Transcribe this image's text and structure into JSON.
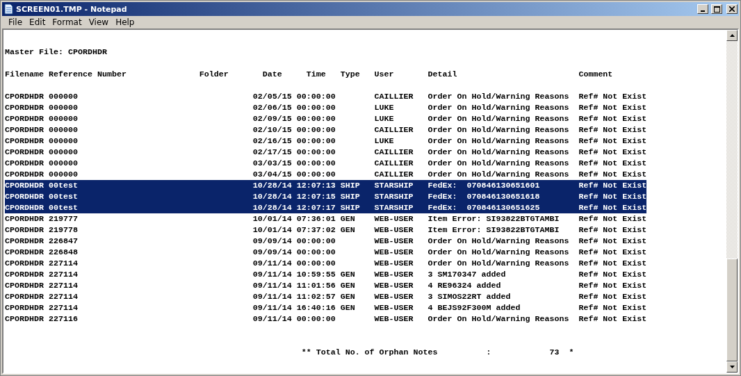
{
  "window": {
    "title": "SCREEN01.TMP - Notepad"
  },
  "menu": [
    "File",
    "Edit",
    "Format",
    "View",
    "Help"
  ],
  "document": {
    "master_line": "Master File: CPORDHDR",
    "header_line": "Filename Reference Number               Folder       Date     Time   Type   User       Detail                         Comment",
    "rows": [
      {
        "text": "CPORDHDR 000000                                    02/05/15 00:00:00        CAILLIER   Order On Hold/Warning Reasons  Ref# Not Exist",
        "selected": false
      },
      {
        "text": "CPORDHDR 000000                                    02/06/15 00:00:00        LUKE       Order On Hold/Warning Reasons  Ref# Not Exist",
        "selected": false
      },
      {
        "text": "CPORDHDR 000000                                    02/09/15 00:00:00        LUKE       Order On Hold/Warning Reasons  Ref# Not Exist",
        "selected": false
      },
      {
        "text": "CPORDHDR 000000                                    02/10/15 00:00:00        CAILLIER   Order On Hold/Warning Reasons  Ref# Not Exist",
        "selected": false
      },
      {
        "text": "CPORDHDR 000000                                    02/16/15 00:00:00        LUKE       Order On Hold/Warning Reasons  Ref# Not Exist",
        "selected": false
      },
      {
        "text": "CPORDHDR 000000                                    02/17/15 00:00:00        CAILLIER   Order On Hold/Warning Reasons  Ref# Not Exist",
        "selected": false
      },
      {
        "text": "CPORDHDR 000000                                    03/03/15 00:00:00        CAILLIER   Order On Hold/Warning Reasons  Ref# Not Exist",
        "selected": false
      },
      {
        "text": "CPORDHDR 000000                                    03/04/15 00:00:00        CAILLIER   Order On Hold/Warning Reasons  Ref# Not Exist",
        "selected": false
      },
      {
        "text": "CPORDHDR 00test                                    10/28/14 12:07:13 SHIP   STARSHIP   FedEx:  070846130651601        Ref# Not Exist",
        "selected": true
      },
      {
        "text": "CPORDHDR 00test                                    10/28/14 12:07:15 SHIP   STARSHIP   FedEx:  070846130651618        Ref# Not Exist",
        "selected": true
      },
      {
        "text": "CPORDHDR 00test                                    10/28/14 12:07:17 SHIP   STARSHIP   FedEx:  070846130651625        Ref# Not Exist",
        "selected": true
      },
      {
        "text": "CPORDHDR 219777                                    10/01/14 07:36:01 GEN    WEB-USER   Item Error: SI93822BTGTAMBI    Ref# Not Exist",
        "selected": false
      },
      {
        "text": "CPORDHDR 219778                                    10/01/14 07:37:02 GEN    WEB-USER   Item Error: SI93822BTGTAMBI    Ref# Not Exist",
        "selected": false
      },
      {
        "text": "CPORDHDR 226847                                    09/09/14 00:00:00        WEB-USER   Order On Hold/Warning Reasons  Ref# Not Exist",
        "selected": false
      },
      {
        "text": "CPORDHDR 226848                                    09/09/14 00:00:00        WEB-USER   Order On Hold/Warning Reasons  Ref# Not Exist",
        "selected": false
      },
      {
        "text": "CPORDHDR 227114                                    09/11/14 00:00:00        WEB-USER   Order On Hold/Warning Reasons  Ref# Not Exist",
        "selected": false
      },
      {
        "text": "CPORDHDR 227114                                    09/11/14 10:59:55 GEN    WEB-USER   3 SM170347 added               Ref# Not Exist",
        "selected": false
      },
      {
        "text": "CPORDHDR 227114                                    09/11/14 11:01:56 GEN    WEB-USER   4 RE96324 added                Ref# Not Exist",
        "selected": false
      },
      {
        "text": "CPORDHDR 227114                                    09/11/14 11:02:57 GEN    WEB-USER   3 SIMOS22RT added              Ref# Not Exist",
        "selected": false
      },
      {
        "text": "CPORDHDR 227114                                    09/11/14 16:40:16 GEN    WEB-USER   4 BEJS92F300M added            Ref# Not Exist",
        "selected": false
      },
      {
        "text": "CPORDHDR 227116                                    09/11/14 00:00:00        WEB-USER   Order On Hold/Warning Reasons  Ref# Not Exist",
        "selected": false
      }
    ],
    "total_line": "** Total No. of Orphan Notes          :            73  *"
  }
}
